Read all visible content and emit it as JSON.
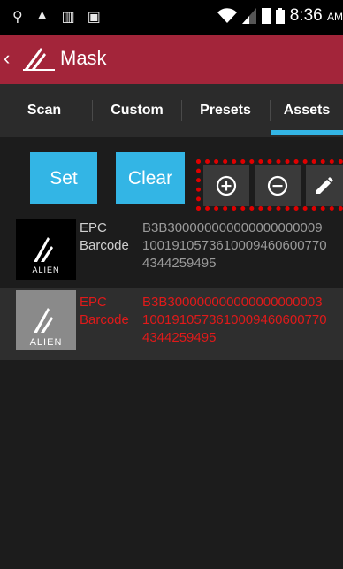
{
  "status_bar": {
    "time": "8:36",
    "ampm": "AM"
  },
  "app_bar": {
    "title": "Mask"
  },
  "tabs": [
    {
      "label": "Scan"
    },
    {
      "label": "Custom"
    },
    {
      "label": "Presets"
    },
    {
      "label": "Assets",
      "selected": true
    }
  ],
  "actions": {
    "set_label": "Set",
    "clear_label": "Clear"
  },
  "tool_icons": [
    "add-circle-icon",
    "remove-circle-icon",
    "edit-pencil-icon"
  ],
  "assets": [
    {
      "epc_label": "EPC",
      "epc": "B3B300000000000000000009",
      "barcode_label": "Barcode",
      "barcode_line1": "1001910573610009460600770",
      "barcode_line2": "4344259495",
      "text_color": "#d0d0d0",
      "thumb": "alien-logo"
    },
    {
      "epc_label": "EPC",
      "epc": "B3B300000000000000000003",
      "barcode_label": "Barcode",
      "barcode_line1": "1001910573610009460600770",
      "barcode_line2": "4344259495",
      "text_color": "#e01a1a",
      "thumb": "alien-logo"
    }
  ],
  "colors": {
    "accent": "#33b5e5",
    "app_bar": "#a3253a",
    "highlight": "#e00000"
  }
}
